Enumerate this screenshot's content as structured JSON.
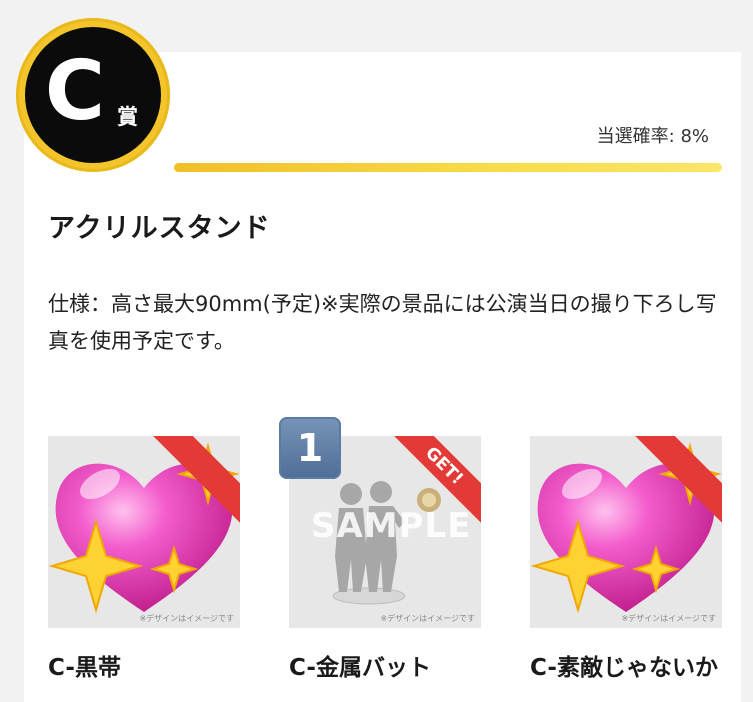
{
  "prize": {
    "grade_letter": "C",
    "grade_suffix": "賞",
    "win_rate": "当選確率: 8%",
    "title": "アクリルスタンド",
    "description": "仕様：高さ最大90mm(予定)※実際の景品には公演当日の撮り下ろし写真を使用予定です。"
  },
  "items": [
    {
      "label": "C-黒帯",
      "image_icon": "sparkling-heart-icon",
      "note": "※デザインはイメージです",
      "corner": ""
    },
    {
      "label": "C-金属バット",
      "image_icon": "acrylic-stand-sample-icon",
      "note": "※デザインはイメージです",
      "corner": "GET!",
      "count": "1",
      "watermark": "SAMPLE"
    },
    {
      "label": "C-素敵じゃないか",
      "image_icon": "sparkling-heart-icon",
      "note": "※デザインはイメージです",
      "corner": ""
    }
  ],
  "colors": {
    "gold": "#f3c52a",
    "badge_black": "#0b0b0b",
    "ribbon_red": "#e33a37",
    "count_badge": "#5c7ba4"
  }
}
